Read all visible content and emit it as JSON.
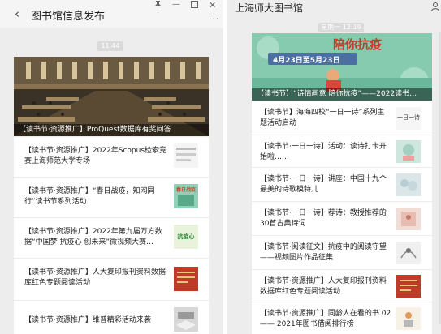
{
  "left": {
    "title": "图书馆信息发布",
    "time": "11:44",
    "more_icon": "···",
    "hero_caption": "【读书节·资源推广】ProQuest数据库有奖问答",
    "items": [
      {
        "text": "【读书节·资源推广】2022年Scopus检索竞赛上海师范大学专场"
      },
      {
        "text": "【读书节·资源推广】“春日战疫，知网同行”读书节系列活动",
        "thumb_text": "春日战疫"
      },
      {
        "text": "【读书节·资源推广】2022年第九届万方数据“中国梦 抗疫心 创未来”微视频大赛…",
        "thumb_text": "抗疫心"
      },
      {
        "text": "【读书节·资源推广】人大复印报刊资料数据库红色专题阅读活动"
      },
      {
        "text": "【读书节·资源推广】维普精彩活动来袭"
      }
    ]
  },
  "right": {
    "title": "上海师大图书馆",
    "time": "星期一 12:19",
    "hero_banner_title": "陪你抗疫",
    "hero_banner_dates": "4月23日至5月23日",
    "hero_caption": "【读书节】“诗情画意 陪你抗疫”——2022读书…",
    "items": [
      {
        "text": "【读书节】海海四校“一日一诗”系列主题活动启动",
        "thumb_text": "一日一诗"
      },
      {
        "text": "【读书节·一日一诗】活动：读诗打卡开始啦……"
      },
      {
        "text": "【读书节·一日一诗】讲座：中国十九个最美的诗歌模特儿"
      },
      {
        "text": "【读书节·一日一诗】荐诗：教授推荐的30首古典诗词"
      },
      {
        "text": "【读书节·阅读征文】抗疫中的阅读守望——视频图片作品征集"
      },
      {
        "text": "【读书节·资源推广】人大复印报刊资料数据库红色专题阅读活动"
      },
      {
        "text": "【读书节·资源推广】同龄人在看的书 02 —— 2021年图书借阅排行榜"
      }
    ]
  },
  "colors": {
    "accent_green": "#5aa88a",
    "banner_blue": "#4a6fa0",
    "red_book": "#c03a2a"
  }
}
